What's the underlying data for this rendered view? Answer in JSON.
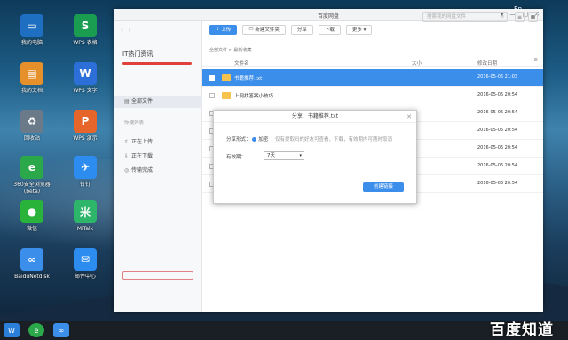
{
  "desktop": {
    "icons": [
      {
        "label": "我的电脑",
        "icon": "computer-icon",
        "color": "#1e6fc2",
        "glyph": "▭"
      },
      {
        "label": "WPS 表格",
        "icon": "wps-sheet-icon",
        "color": "#1a9d50",
        "glyph": "S"
      },
      {
        "label": "我的文档",
        "icon": "documents-folder-icon",
        "color": "#e5902a",
        "glyph": "▤"
      },
      {
        "label": "WPS 文字",
        "icon": "wps-writer-icon",
        "color": "#2d6fd8",
        "glyph": "W"
      },
      {
        "label": "回收站",
        "icon": "recycle-bin-icon",
        "color": "#6b7a88",
        "glyph": "♻"
      },
      {
        "label": "WPS 演示",
        "icon": "wps-presentation-icon",
        "color": "#e5652a",
        "glyph": "P"
      },
      {
        "label": "360安全浏览器 (beta)",
        "icon": "360-browser-icon",
        "color": "#2aa84a",
        "glyph": "e"
      },
      {
        "label": "钉钉",
        "icon": "dingtalk-icon",
        "color": "#2d8cf0",
        "glyph": "✈"
      },
      {
        "label": "微信",
        "icon": "wechat-icon",
        "color": "#29b33a",
        "glyph": "●"
      },
      {
        "label": "MiTalk",
        "icon": "mitalk-icon",
        "color": "#2db56a",
        "glyph": "米"
      },
      {
        "label": "BaiduNetdisk",
        "icon": "baidu-netdisk-icon",
        "color": "#3b8eea",
        "glyph": "∞"
      },
      {
        "label": "邮件中心",
        "icon": "mail-icon",
        "color": "#2d8cf0",
        "glyph": "✉"
      }
    ]
  },
  "taskbar": {
    "lang": "En",
    "watermark": "百度知道"
  },
  "window": {
    "title": "百度网盘",
    "controls": [
      "▾",
      "—",
      "▢",
      "✕"
    ],
    "toolbar": {
      "upload": "上传",
      "new_folder": "新建文件夹",
      "share": "分享",
      "download": "下载",
      "more": "更多 ▾",
      "search_placeholder": "搜索我的网盘文件"
    },
    "breadcrumb": "全部文件 > 最新收藏",
    "columns": {
      "name": "文件名",
      "size": "大小",
      "modified": "修改日期"
    },
    "files": [
      {
        "name": "书籍推荐.txt",
        "size": "",
        "time": "2016-05-06 21:03",
        "selected": true
      },
      {
        "name": "上网找答案小技巧",
        "size": "",
        "time": "2016-05-06 20:54",
        "selected": false
      },
      {
        "name": "",
        "size": "",
        "time": "2016-05-06 20:54",
        "selected": false
      },
      {
        "name": "",
        "size": "",
        "time": "2016-05-06 20:54",
        "selected": false
      },
      {
        "name": "",
        "size": "",
        "time": "2016-05-06 20:54",
        "selected": false
      },
      {
        "name": "",
        "size": "",
        "time": "2016-05-06 20:54",
        "selected": false
      },
      {
        "name": "",
        "size": "",
        "time": "2016-05-06 20:54",
        "selected": false
      }
    ],
    "sidebar": {
      "user": "IT热门资讯",
      "quota_fraction": 1.0,
      "quota_text": "",
      "all_files": "全部文件",
      "transfer_group": "传输列表",
      "uploading": "正在上传",
      "downloading": "正在下载",
      "finished": "传输完成",
      "bottom_btn": "",
      "bottom_link_1": "",
      "bottom_link_2": ""
    }
  },
  "dialog": {
    "title": "分享：书籍推荐.txt",
    "share_type_label": "分享形式：",
    "option_encrypted": "加密",
    "option_desc": "仅有提取码的好友可查看，下载，有效期内可随时取消",
    "expiry_label": "有效期：",
    "expiry_value": "7天",
    "create_button": "创建链接"
  }
}
